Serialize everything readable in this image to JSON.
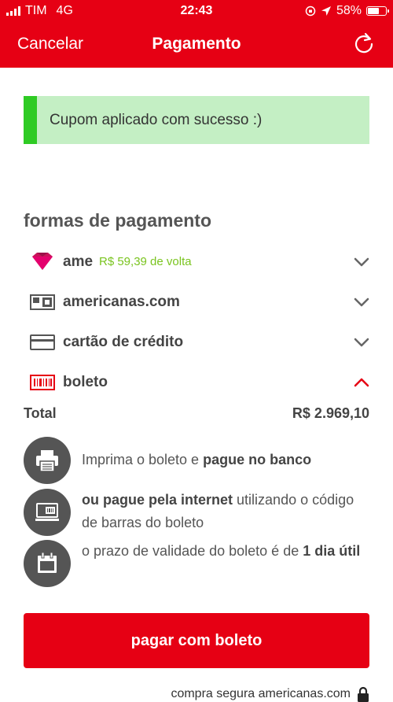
{
  "status_bar": {
    "carrier": "TIM",
    "network": "4G",
    "time": "22:43",
    "battery_percent": "58%",
    "battery_level": 0.58
  },
  "nav": {
    "cancel_label": "Cancelar",
    "title": "Pagamento",
    "refresh_icon": "refresh-icon"
  },
  "alert": {
    "message": "Cupom aplicado com sucesso :)",
    "bg_color": "#c4efc4",
    "bar_color": "#2fcb24"
  },
  "section_title": "formas de pagamento",
  "payment_methods": [
    {
      "label": "ame",
      "sublabel": "R$ 59,39 de volta",
      "icon": "ame-heart-icon",
      "expanded": false
    },
    {
      "label": "americanas.com",
      "icon": "gift-card-icon",
      "expanded": false
    },
    {
      "label": "cartão de crédito",
      "icon": "credit-card-icon",
      "expanded": false
    },
    {
      "label": "boleto",
      "icon": "barcode-icon",
      "expanded": true
    }
  ],
  "total": {
    "label": "Total",
    "amount": "R$ 2.969,10"
  },
  "boleto_info": [
    {
      "icon": "printer-icon",
      "pre": "Imprima o boleto e ",
      "bold": "pague no banco",
      "post": ""
    },
    {
      "icon": "laptop-barcode-icon",
      "pre": "",
      "bold": "ou pague pela internet",
      "post": " utilizando o código de barras do boleto"
    },
    {
      "icon": "calendar-icon",
      "pre": "o prazo de validade do boleto é de ",
      "bold": "1 dia útil",
      "post": ""
    }
  ],
  "cta_label": "pagar com boleto",
  "footer": {
    "text": "compra segura americanas.com",
    "icon": "lock-icon"
  },
  "colors": {
    "brand_red": "#e60014",
    "cashback_green": "#7ac41f",
    "icon_gray": "#555555"
  }
}
